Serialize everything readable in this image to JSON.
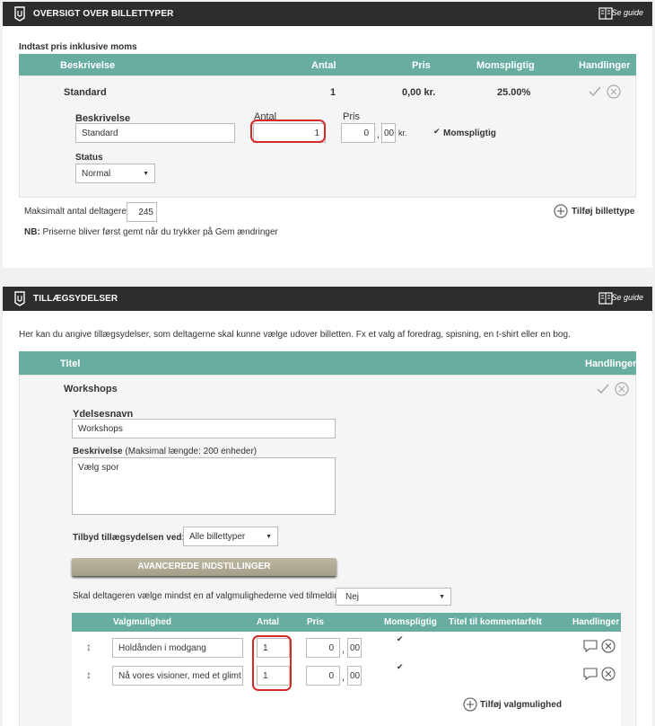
{
  "ticket_panel": {
    "title": "OVERSIGT OVER BILLETTYPER",
    "guide_label": "Se guide",
    "subtitle": "Indtast pris inklusive moms",
    "columns": {
      "description": "Beskrivelse",
      "quantity": "Antal",
      "price": "Pris",
      "vat": "Momspligtig",
      "actions": "Handlinger"
    },
    "row": {
      "name": "Standard",
      "quantity": "1",
      "price": "0,00 kr.",
      "vat": "25.00%"
    },
    "form": {
      "description_label": "Beskrivelse",
      "description_value": "Standard",
      "quantity_label": "Antal",
      "quantity_value": "1",
      "price_label": "Pris",
      "price_whole": "0",
      "price_sep": ",",
      "price_decimals": "00",
      "currency": "kr.",
      "vat_label": "Momspligtig",
      "status_label": "Status",
      "status_value": "Normal"
    },
    "max_label": "Maksimalt antal deltagere:",
    "max_value": "245",
    "add_ticket_label": "Tilføj billettype",
    "note_prefix": "NB:",
    "note_text": " Priserne bliver først gemt når du trykker på Gem ændringer"
  },
  "addon_panel": {
    "title": "TILLÆGSYDELSER",
    "guide_label": "Se guide",
    "intro": "Her kan du angive tillægsydelser, som deltagerne skal kunne vælge udover billetten. Fx et valg af foredrag, spisning, en t-shirt eller en bog.",
    "columns": {
      "title": "Titel",
      "actions": "Handlinger"
    },
    "row": {
      "name": "Workshops"
    },
    "form": {
      "name_label": "Ydelsesnavn",
      "name_value": "Workshops",
      "desc_label": "Beskrivelse",
      "desc_hint": "(Maksimal længde: 200 enheder)",
      "desc_value": "Vælg spor",
      "offer_label": "Tilbyd tillægsydelsen ved:",
      "offer_value": "Alle billettyper",
      "advanced_label": "AVANCEREDE INDSTILLINGER",
      "must_choose_label": "Skal deltageren vælge mindst en af valgmulighederne ved tilmelding:",
      "must_choose_value": "Nej"
    },
    "options_columns": {
      "option": "Valgmulighed",
      "quantity": "Antal",
      "price": "Pris",
      "vat": "Momspligtig",
      "comment": "Titel til kommentarfelt",
      "actions": "Handlinger"
    },
    "options": [
      {
        "name": "Holdånden i modgang",
        "quantity": "1",
        "price_whole": "0",
        "price_decimals": "00"
      },
      {
        "name": "Nå vores visioner, med et glimt i øje",
        "quantity": "1",
        "price_whole": "0",
        "price_decimals": "00"
      }
    ],
    "price_sep": ",",
    "add_option_label": "Tilføj valgmulighed"
  }
}
